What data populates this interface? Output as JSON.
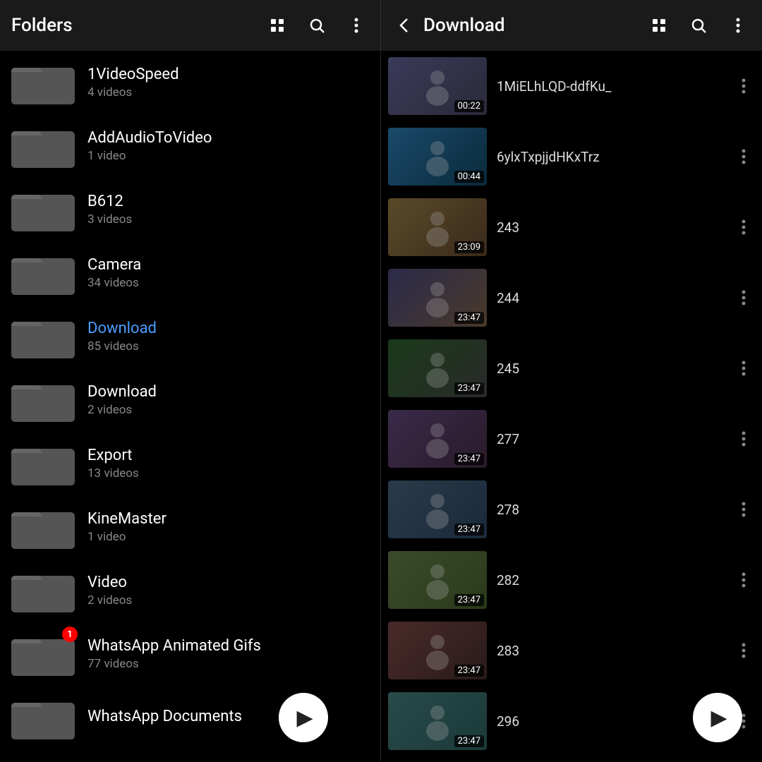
{
  "left_header": {
    "title": "Folders",
    "icons": [
      "grid",
      "search",
      "more"
    ]
  },
  "right_header": {
    "back": "←",
    "title": "Download",
    "icons": [
      "grid",
      "search",
      "more"
    ]
  },
  "folders": [
    {
      "name": "1VideoSpeed",
      "count": "4 videos",
      "active": false,
      "badge": null
    },
    {
      "name": "AddAudioToVideo",
      "count": "1 video",
      "active": false,
      "badge": null
    },
    {
      "name": "B612",
      "count": "3 videos",
      "active": false,
      "badge": null
    },
    {
      "name": "Camera",
      "count": "34 videos",
      "active": false,
      "badge": null
    },
    {
      "name": "Download",
      "count": "85 videos",
      "active": true,
      "badge": null
    },
    {
      "name": "Download",
      "count": "2 videos",
      "active": false,
      "badge": null
    },
    {
      "name": "Export",
      "count": "13 videos",
      "active": false,
      "badge": null
    },
    {
      "name": "KineMaster",
      "count": "1 video",
      "active": false,
      "badge": null
    },
    {
      "name": "Video",
      "count": "2 videos",
      "active": false,
      "badge": null
    },
    {
      "name": "WhatsApp Animated Gifs",
      "count": "77 videos",
      "active": false,
      "badge": "1"
    },
    {
      "name": "WhatsApp Documents",
      "count": "",
      "active": false,
      "badge": null
    }
  ],
  "videos": [
    {
      "id": "v1",
      "name": "1MiELhLQD-ddfKu_",
      "duration": "00:22",
      "thumb_class": "thumb-trump"
    },
    {
      "id": "v2",
      "name": "6ylxTxpjjdHKxTrz",
      "duration": "00:44",
      "thumb_class": "thumb-news"
    },
    {
      "id": "v3",
      "name": "243",
      "duration": "23:09",
      "thumb_class": "thumb-blonde"
    },
    {
      "id": "v4",
      "name": "244",
      "duration": "23:47",
      "thumb_class": "thumb-1"
    },
    {
      "id": "v5",
      "name": "245",
      "duration": "23:47",
      "thumb_class": "thumb-2"
    },
    {
      "id": "v6",
      "name": "277",
      "duration": "23:47",
      "thumb_class": "thumb-3"
    },
    {
      "id": "v7",
      "name": "278",
      "duration": "23:47",
      "thumb_class": "thumb-4"
    },
    {
      "id": "v8",
      "name": "282",
      "duration": "23:47",
      "thumb_class": "thumb-5"
    },
    {
      "id": "v9",
      "name": "283",
      "duration": "23:47",
      "thumb_class": "thumb-6"
    },
    {
      "id": "v10",
      "name": "296",
      "duration": "23:47",
      "thumb_class": "thumb-7"
    }
  ],
  "fab": {
    "play_icon": "▶"
  }
}
